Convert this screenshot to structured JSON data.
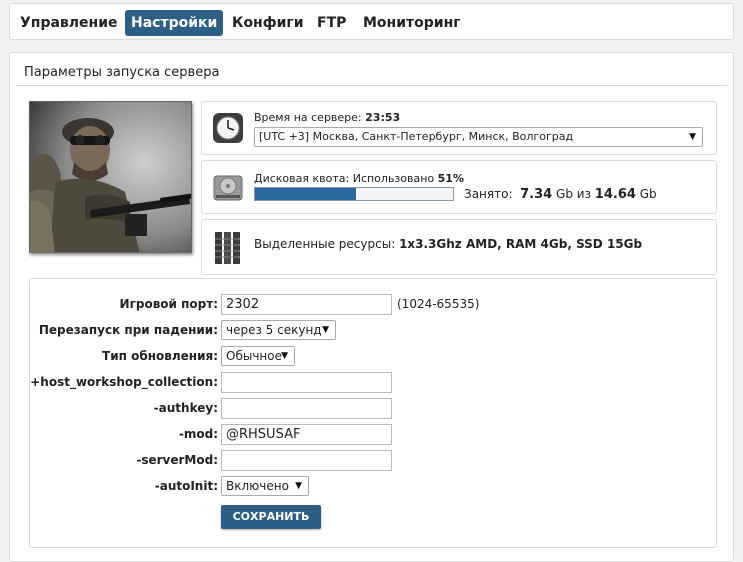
{
  "nav": {
    "items": [
      "Управление",
      "Настройки",
      "Конфиги",
      "FTP",
      "Мониторинг"
    ],
    "active_index": 1
  },
  "panel": {
    "title": "Параметры запуска сервера"
  },
  "server_time": {
    "label": "Время на сервере:",
    "value": "23:53",
    "timezone": "[UTC +3] Москва, Санкт-Петербург, Минск, Волгоград"
  },
  "disk": {
    "label": "Дисковая квота: Использовано",
    "percent": "51%",
    "fill_fraction": 0.51,
    "used_label": "Занято:",
    "used_value": "7.34",
    "used_unit": "Gb из",
    "total_value": "14.64",
    "total_unit": "Gb"
  },
  "resources": {
    "label": "Выделенные ресурсы:",
    "value": "1x3.3Ghz AMD, RAM 4Gb, SSD 15Gb"
  },
  "form": {
    "game_port": {
      "label": "Игровой порт:",
      "value": "2302",
      "hint": "(1024-65535)"
    },
    "restart": {
      "label": "Перезапуск при падении:",
      "value": "через 5 секунд"
    },
    "update_type": {
      "label": "Тип обновления:",
      "value": "Обычное"
    },
    "workshop": {
      "label": "+host_workshop_collection:",
      "value": ""
    },
    "authkey": {
      "label": "-authkey:",
      "value": ""
    },
    "mod": {
      "label": "-mod:",
      "value": "@RHSUSAF"
    },
    "servermod": {
      "label": "-serverMod:",
      "value": ""
    },
    "autoinit": {
      "label": "-autoInit:",
      "value": "Включено"
    },
    "save_label": "СОХРАНИТЬ"
  },
  "colors": {
    "accent": "#2d5f86",
    "progress": "#2b6aa0"
  }
}
